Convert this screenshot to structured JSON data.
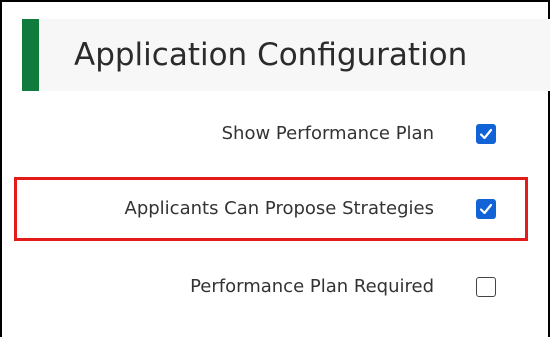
{
  "header": {
    "title": "Application Configuration",
    "accent_color": "#117a3d"
  },
  "settings": [
    {
      "label": "Show Performance Plan",
      "checked": true
    },
    {
      "label": "Applicants Can Propose Strategies",
      "checked": true,
      "highlighted": true
    },
    {
      "label": "Performance Plan Required",
      "checked": false
    }
  ],
  "colors": {
    "checkbox_checked": "#1264d6",
    "highlight_border": "#e31b1b"
  }
}
